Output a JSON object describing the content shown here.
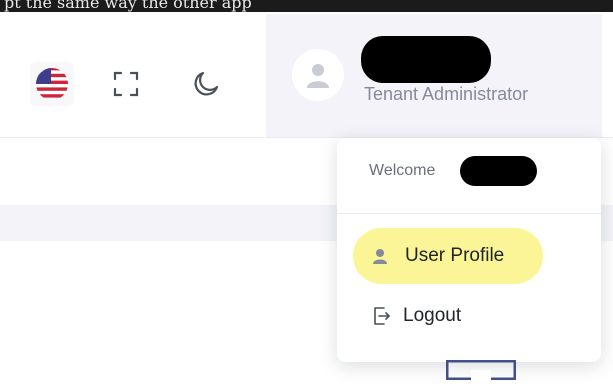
{
  "page_top_text": "pt the same way the other app",
  "header": {
    "flag_icon": "us-flag-icon",
    "fullscreen_icon": "fullscreen-icon",
    "theme_icon": "moon-icon",
    "user": {
      "avatar_icon": "user-avatar-icon",
      "role": "Tenant Administrator"
    }
  },
  "dropdown": {
    "welcome_label": "Welcome",
    "items": [
      {
        "label": "User Profile",
        "icon": "user-icon"
      },
      {
        "label": "Logout",
        "icon": "logout-icon"
      }
    ]
  },
  "colors": {
    "header_user_bg": "#f3f3f9",
    "profile_highlight": "#fcf597",
    "muted_text": "#878a99",
    "accent_blue": "#405189"
  }
}
